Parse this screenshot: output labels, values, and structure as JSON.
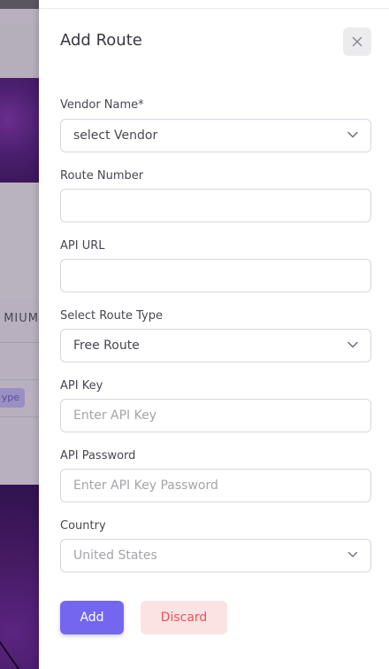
{
  "background": {
    "partial_label": "MIUM",
    "partial_badge": "ype"
  },
  "drawer": {
    "title": "Add Route",
    "close_icon": "close-icon"
  },
  "form": {
    "vendor": {
      "label": "Vendor Name*",
      "value": "select Vendor"
    },
    "route_number": {
      "label": "Route Number",
      "value": ""
    },
    "api_url": {
      "label": "API URL",
      "value": ""
    },
    "route_type": {
      "label": "Select Route Type",
      "value": "Free Route"
    },
    "api_key": {
      "label": "API Key",
      "placeholder": "Enter API Key"
    },
    "api_password": {
      "label": "API Password",
      "placeholder": "Enter API Key Password"
    },
    "country": {
      "label": "Country",
      "value": "United States"
    }
  },
  "actions": {
    "add_label": "Add",
    "discard_label": "Discard"
  },
  "colors": {
    "primary": "#7367f0",
    "danger": "#ea5455",
    "danger_bg": "#fbe3e4"
  }
}
